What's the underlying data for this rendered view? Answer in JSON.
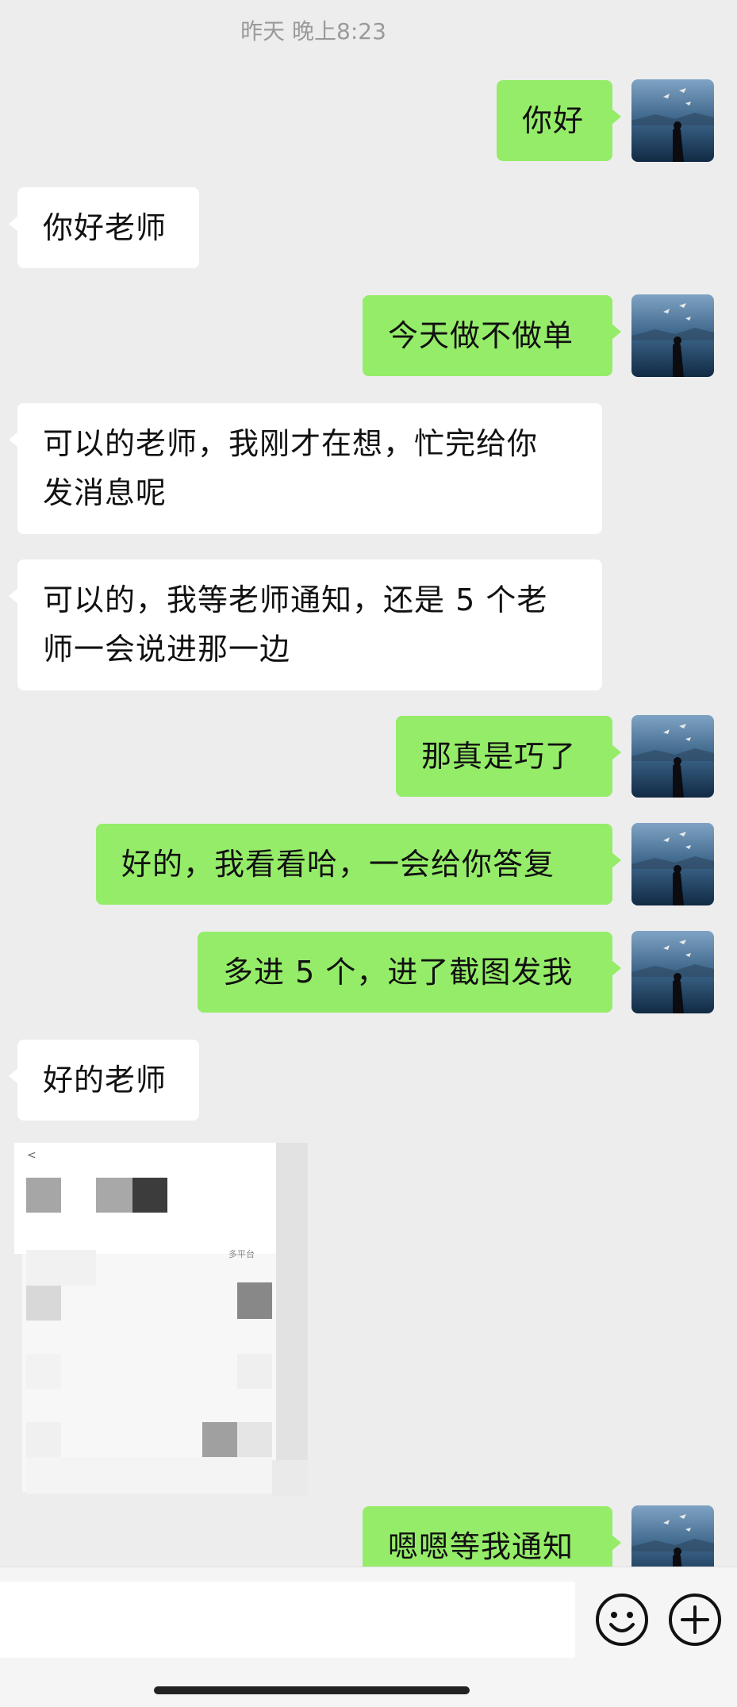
{
  "chat": {
    "timestamp": "昨天 晚上8:23",
    "messages": [
      {
        "text": "你好"
      },
      {
        "text": "你好老师"
      },
      {
        "text": "今天做不做单"
      },
      {
        "lines": [
          "可以的老师，我刚才在想，忙完给你",
          "发消息呢"
        ]
      },
      {
        "lines": [
          "可以的，我等老师通知，还是 5 个老",
          "师一会说进那一边"
        ]
      },
      {
        "text": "那真是巧了"
      },
      {
        "text": "好的，我看看哈，一会给你答复"
      },
      {
        "text": "多进 5 个，进了截图发我"
      },
      {
        "text": "好的老师"
      },
      {
        "text": "嗯嗯等我通知"
      }
    ]
  },
  "image_message": {
    "back_glyph": "<",
    "caption_text": "多平台"
  },
  "input_bar": {
    "value": "",
    "emoji_icon": "emoji-face-icon",
    "plus_icon": "plus-circle-icon"
  },
  "colors": {
    "background": "#ededed",
    "outgoing_bubble": "#95ec69",
    "incoming_bubble": "#ffffff",
    "timestamp_text": "#9a9a9a"
  }
}
